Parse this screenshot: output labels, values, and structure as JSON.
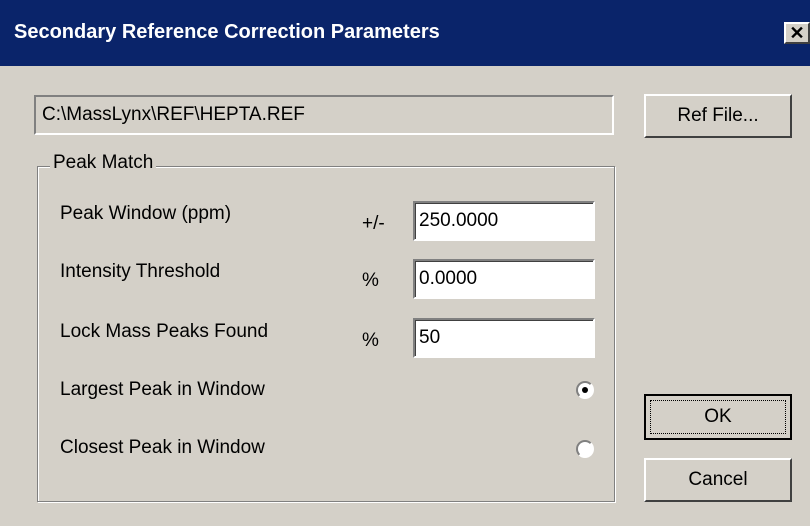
{
  "window": {
    "title": "Secondary Reference Correction Parameters",
    "close_label": "✕",
    "titlebar_color": "#0a246a"
  },
  "ref_file": {
    "path": "C:\\MassLynx\\REF\\HEPTA.REF",
    "button_label": "Ref File..."
  },
  "peak_match": {
    "group_label": "Peak Match",
    "peak_window": {
      "label": "Peak Window (ppm)",
      "unit": "+/-",
      "value": "250.0000"
    },
    "intensity_threshold": {
      "label": "Intensity Threshold",
      "unit": "%",
      "value": "0.0000"
    },
    "lock_mass_peaks": {
      "label": "Lock Mass Peaks Found",
      "unit": "%",
      "value": "50"
    },
    "largest_peak": {
      "label": "Largest Peak in Window",
      "selected": true
    },
    "closest_peak": {
      "label": "Closest Peak in Window",
      "selected": false
    }
  },
  "buttons": {
    "ok_label": "OK",
    "cancel_label": "Cancel"
  }
}
